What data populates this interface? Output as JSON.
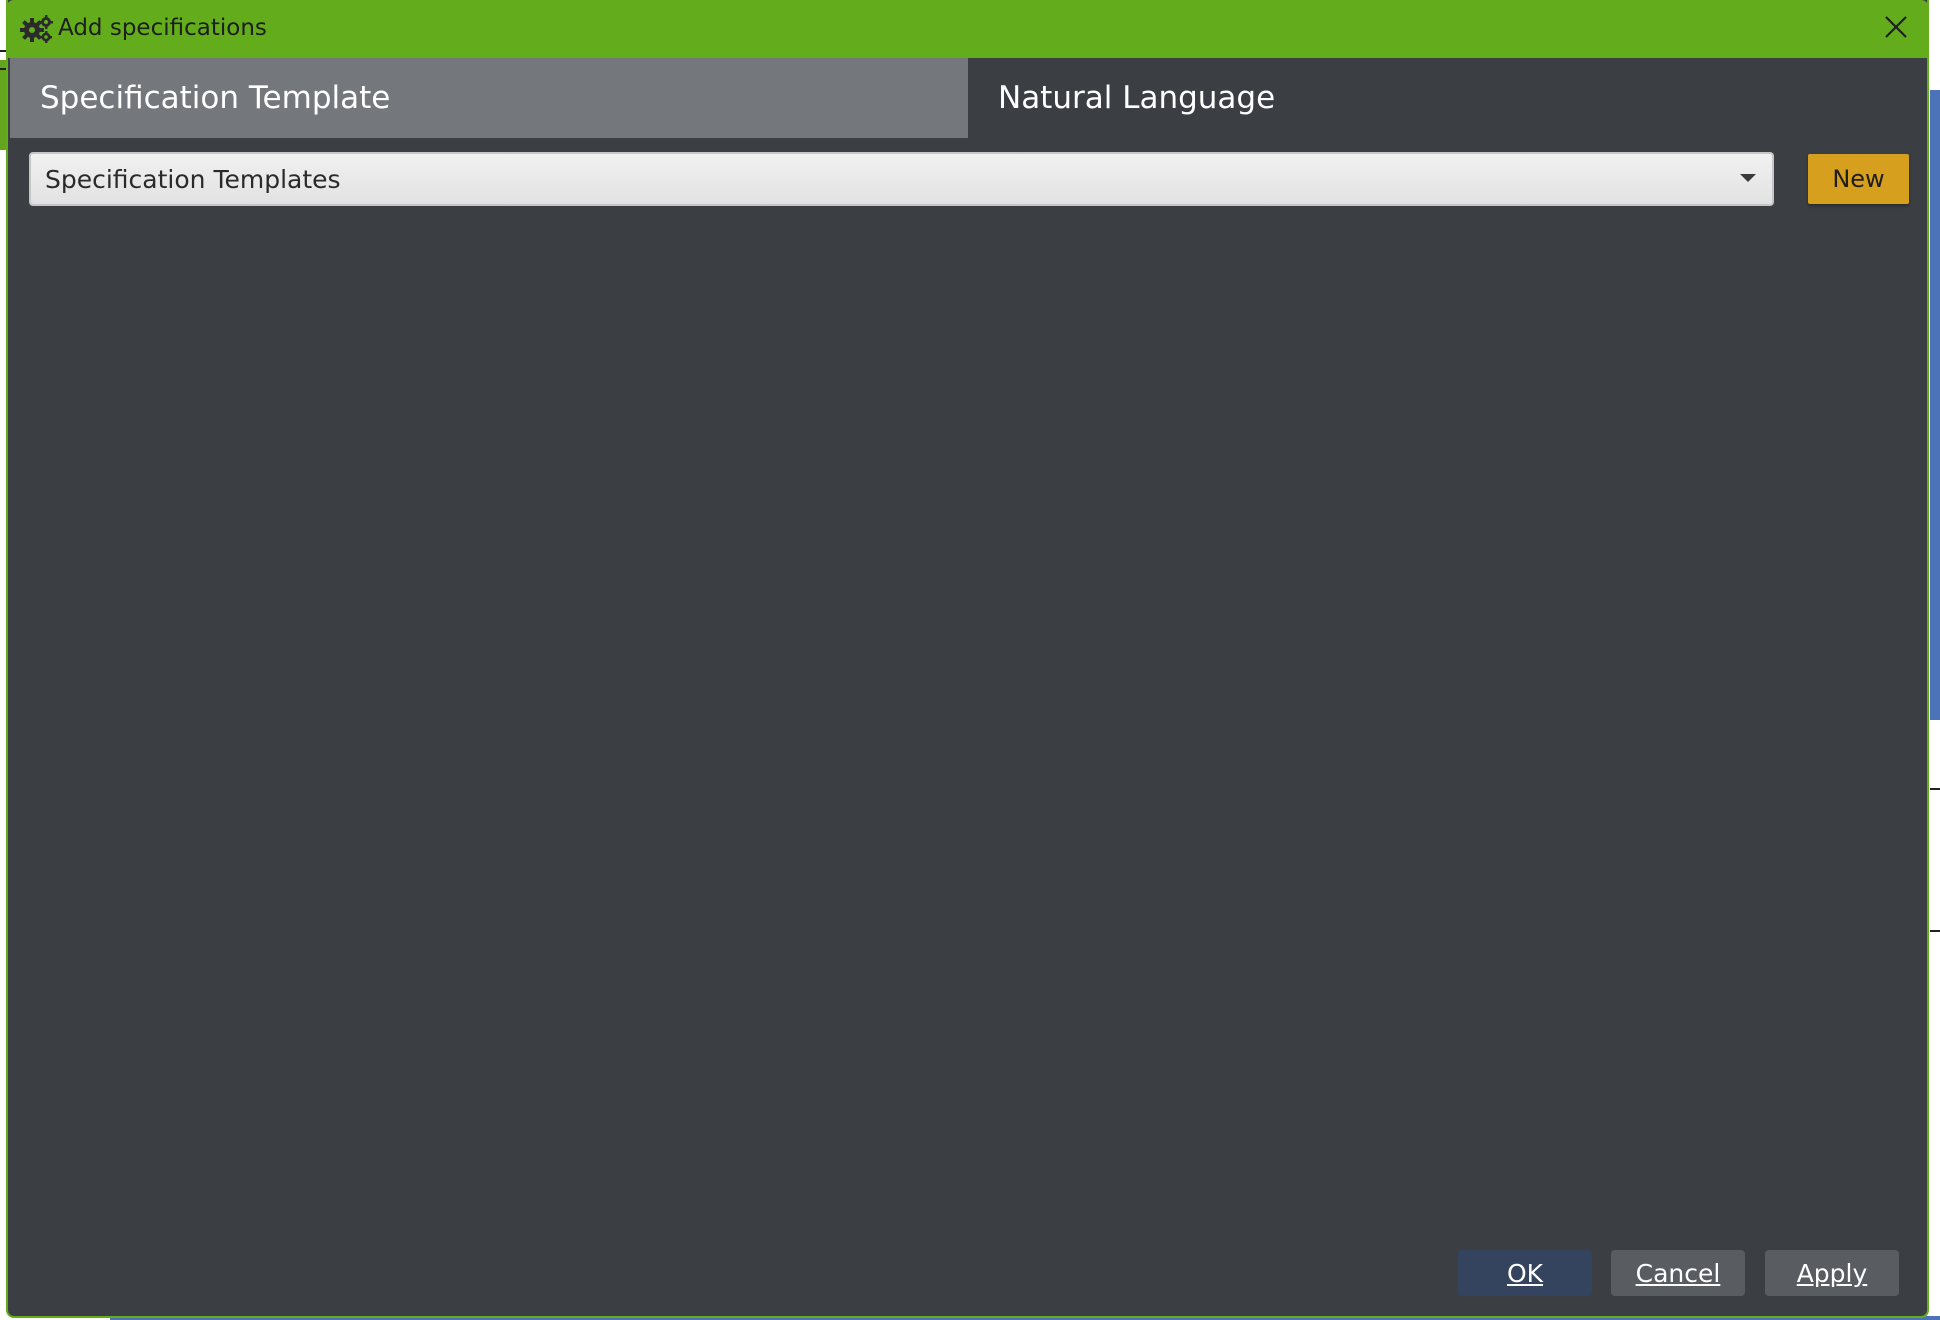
{
  "window": {
    "title": "Add specifications",
    "icon": "gears-icon",
    "close_icon": "close-icon"
  },
  "tabs": [
    {
      "label": "Specification Template",
      "active": true
    },
    {
      "label": "Natural Language",
      "active": false
    }
  ],
  "template_select": {
    "value": "Specification Templates",
    "arrow_icon": "chevron-down-icon"
  },
  "new_button": {
    "label": "New"
  },
  "footer": {
    "ok_label": "OK",
    "cancel_label": "Cancel",
    "apply_label": "Apply"
  },
  "colors": {
    "titlebar": "#63ad1c",
    "dialog_bg": "#3b3f44",
    "active_tab": "#74787c",
    "new_button": "#d79f1e",
    "ok_button": "#34445e"
  }
}
